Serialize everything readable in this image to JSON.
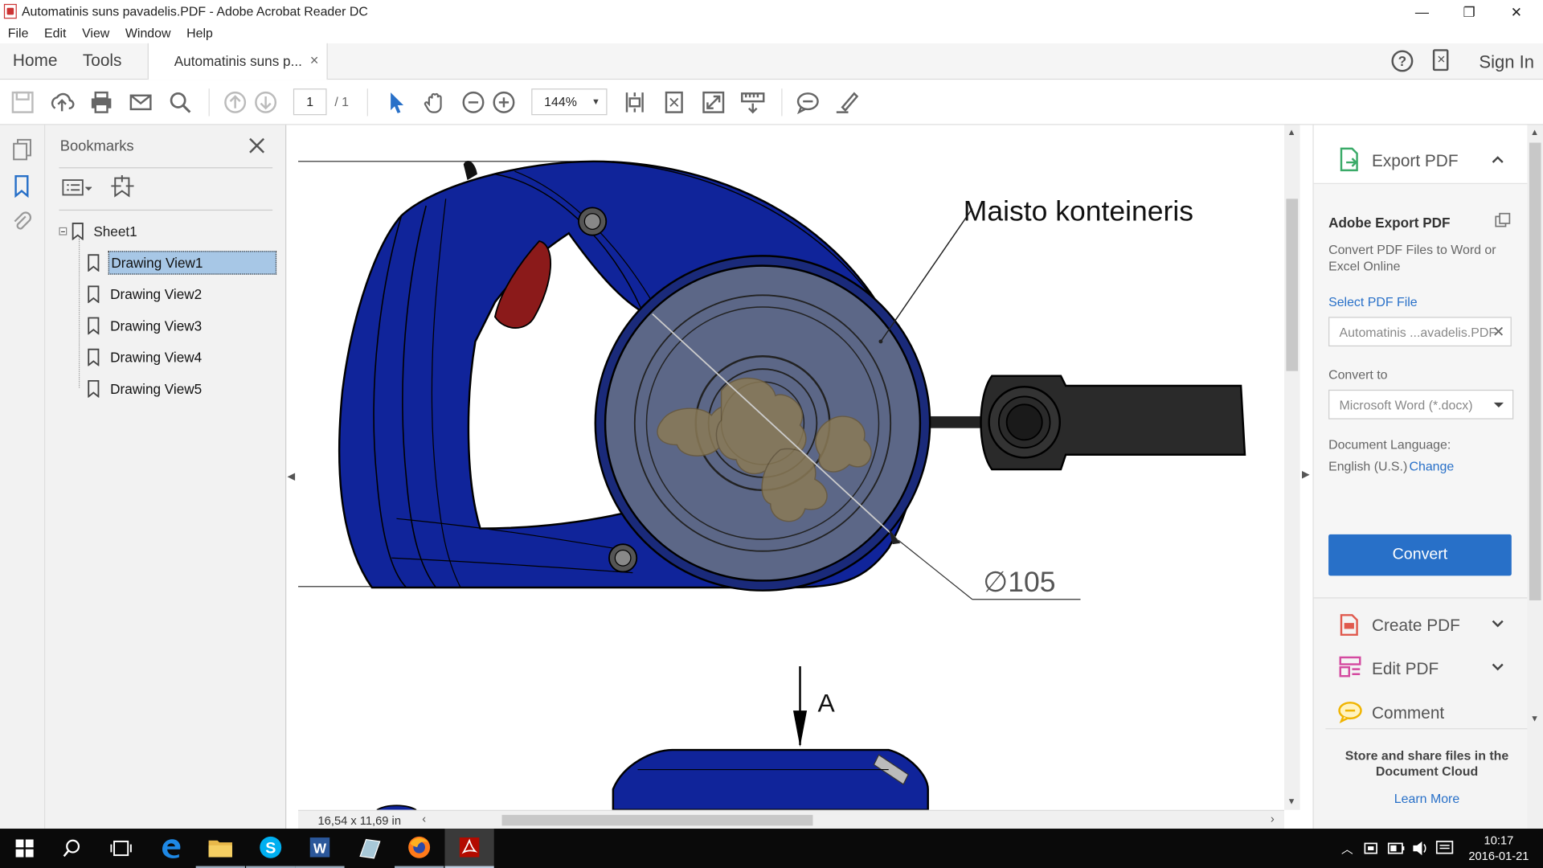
{
  "window": {
    "title": "Automatinis suns pavadelis.PDF - Adobe Acrobat Reader DC",
    "minimize_glyph": "—",
    "restore_glyph": "❐",
    "close_glyph": "✕"
  },
  "menu": [
    "File",
    "Edit",
    "View",
    "Window",
    "Help"
  ],
  "tabs": {
    "home": "Home",
    "tools": "Tools",
    "document": "Automatinis suns p...",
    "close_glyph": "×",
    "sign_in": "Sign In"
  },
  "toolbar": {
    "page_current": "1",
    "page_total": "/ 1",
    "zoom": "144%"
  },
  "bookmarks": {
    "title": "Bookmarks",
    "root": "Sheet1",
    "items": [
      "Drawing View1",
      "Drawing View2",
      "Drawing View3",
      "Drawing View4",
      "Drawing View5"
    ],
    "selected_index": 0
  },
  "document": {
    "label_container": "Maisto konteineris",
    "dimension": "105",
    "diameter_symbol": "∅",
    "section_label": "A",
    "page_size": "16,54 x 11,69 in",
    "colors": {
      "body_blue": "#10249a",
      "lens_gray": "#5c6787",
      "trigger_red": "#8b1a1a",
      "handle_dark": "#2a2a2a"
    }
  },
  "right_panel": {
    "export_title": "Export PDF",
    "adobe_export": "Adobe Export PDF",
    "description": "Convert PDF Files to Word or Excel Online",
    "select_pdf": "Select PDF File",
    "file_name": "Automatinis ...avadelis.PDF",
    "convert_to_label": "Convert to",
    "format": "Microsoft Word (*.docx)",
    "doc_lang_label": "Document Language:",
    "doc_lang": "English (U.S.)",
    "change": "Change",
    "convert_button": "Convert",
    "create_pdf": "Create PDF",
    "edit_pdf": "Edit PDF",
    "comment": "Comment",
    "cloud_text": "Store and share files in the Document Cloud",
    "learn_more": "Learn More",
    "accent": "#2870c8"
  },
  "taskbar": {
    "time": "10:17",
    "date": "2016-01-21"
  }
}
